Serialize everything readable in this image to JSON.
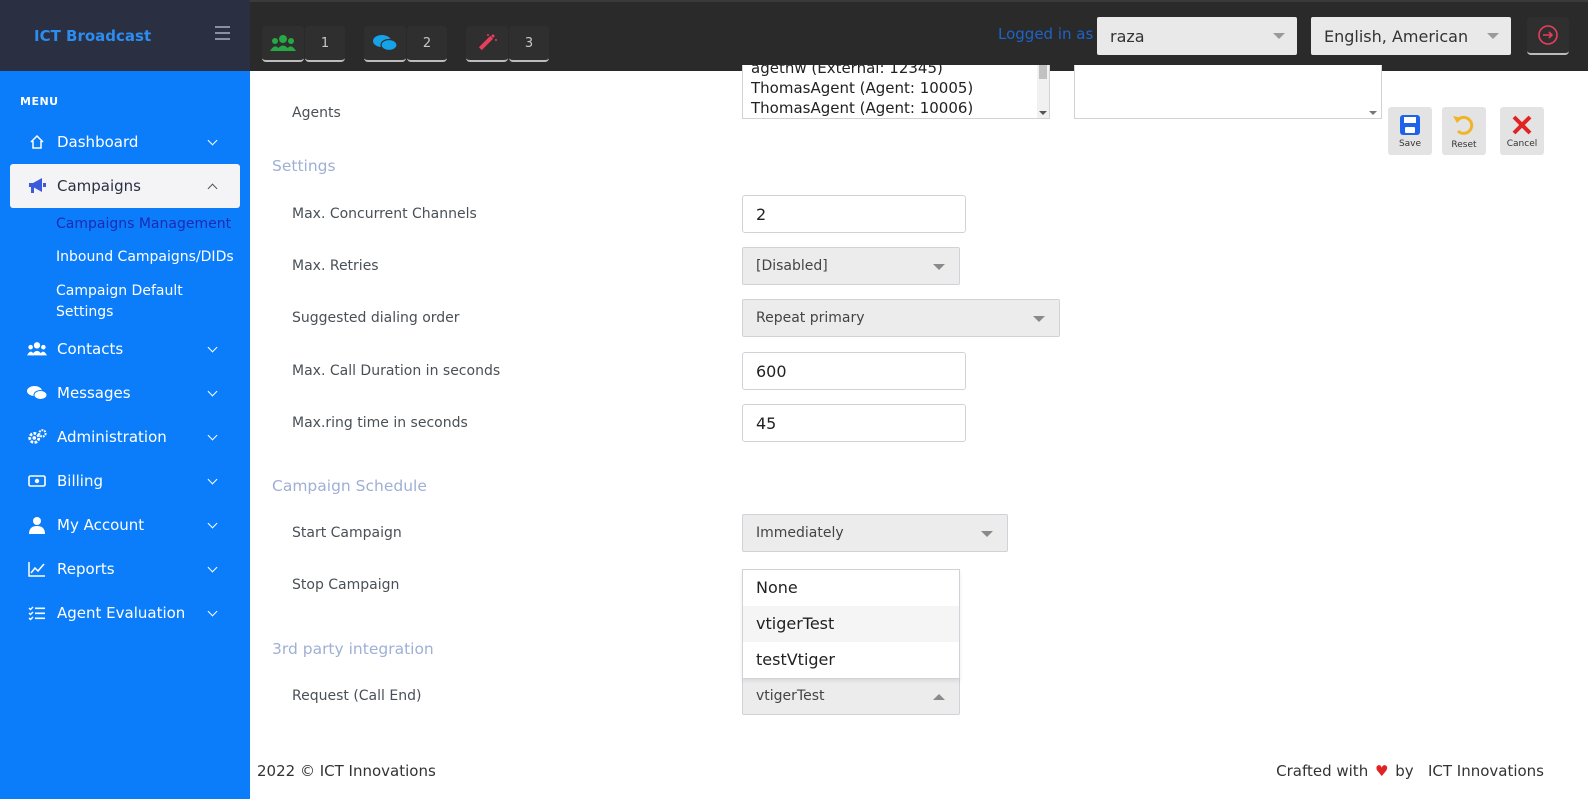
{
  "brand": {
    "name": "ICT Broadcast"
  },
  "topbar": {
    "counters": [
      {
        "icon": "users-icon",
        "count": "1",
        "color": "#27a844"
      },
      {
        "icon": "chat-icon",
        "count": "2",
        "color": "#16a2e8"
      },
      {
        "icon": "magic-wand-icon",
        "count": "3",
        "color": "#e83e5c"
      }
    ],
    "logged_in_label": "Logged in as :",
    "user": "raza",
    "language": "English, American"
  },
  "sidebar": {
    "menu_title": "MENU",
    "items": [
      {
        "label": "Dashboard",
        "icon": "home-icon"
      },
      {
        "label": "Campaigns",
        "icon": "megaphone-icon"
      },
      {
        "label": "Contacts",
        "icon": "users-icon"
      },
      {
        "label": "Messages",
        "icon": "chat-icon"
      },
      {
        "label": "Administration",
        "icon": "gears-icon"
      },
      {
        "label": "Billing",
        "icon": "money-icon"
      },
      {
        "label": "My Account",
        "icon": "user-icon"
      },
      {
        "label": "Reports",
        "icon": "chart-icon"
      },
      {
        "label": "Agent Evaluation",
        "icon": "checklist-icon"
      }
    ],
    "campaign_subitems": [
      "Campaigns Management",
      "Inbound Campaigns/DIDs",
      "Campaign Default Settings"
    ]
  },
  "form": {
    "agents_label": "Agents",
    "agents_options": [
      "agethw (External: 12345)",
      "ThomasAgent (Agent: 10005)",
      "ThomasAgent (Agent: 10006)"
    ],
    "actions": {
      "save": "Save",
      "reset": "Reset",
      "cancel": "Cancel"
    },
    "settings_head": "Settings",
    "max_channels_label": "Max. Concurrent Channels",
    "max_channels_value": "2",
    "max_retries_label": "Max. Retries",
    "max_retries_value": "[Disabled]",
    "dialing_order_label": "Suggested dialing order",
    "dialing_order_value": "Repeat primary",
    "max_duration_label": "Max. Call Duration in seconds",
    "max_duration_value": "600",
    "ring_time_label": "Max.ring time in seconds",
    "ring_time_value": "45",
    "schedule_head": "Campaign Schedule",
    "start_label": "Start Campaign",
    "start_value": "Immediately",
    "stop_label": "Stop Campaign",
    "integration_head": "3rd party integration",
    "request_label": "Request (Call End)",
    "request_value": "vtigerTest",
    "request_options": [
      "None",
      "vtigerTest",
      "testVtiger"
    ]
  },
  "footer": {
    "copyright": "2022 © ICT Innovations",
    "crafted_prefix": "Crafted with",
    "crafted_by": "by",
    "company": "ICT Innovations"
  },
  "colors": {
    "sidebar_bg": "#0b7dfb",
    "header_bg": "#2a2a2a",
    "brand_bg": "#2a3042",
    "section_head": "#9fb0d4",
    "save_blue": "#1e63e9",
    "reset_yellow": "#f0b429",
    "cancel_red": "#e02424"
  }
}
